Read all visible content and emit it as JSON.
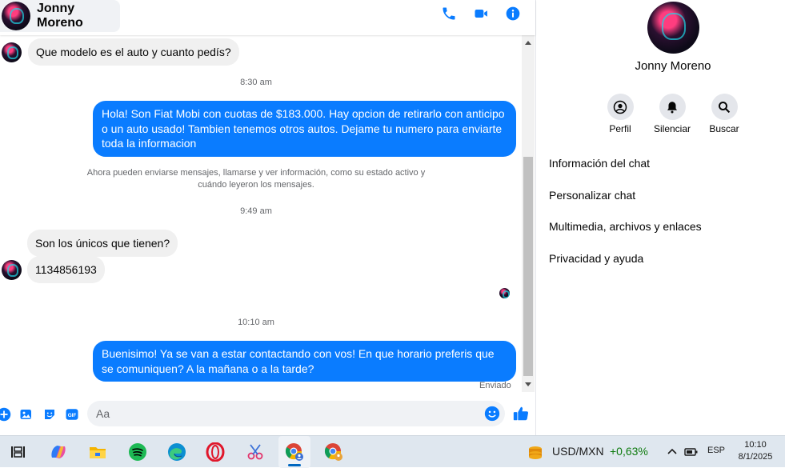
{
  "contact": {
    "name": "Jonny Moreno"
  },
  "messages": {
    "incoming_1": "Que modelo es el auto y cuanto pedís?",
    "time_1": "8:30 am",
    "outgoing_1": "Hola! Son Fiat Mobi con cuotas de $183.000. Hay opcion de retirarlo con anticipo o un auto usado! Tambien tenemos otros autos. Dejame tu numero para enviarte toda la informacion",
    "notice": "Ahora pueden enviarse mensajes, llamarse y ver información, como su estado activo y cuándo leyeron los mensajes.",
    "time_2": "9:49 am",
    "incoming_2": "Son los únicos que tienen?",
    "incoming_3": "1134856193",
    "time_3": "10:10 am",
    "outgoing_2": "Buenisimo! Ya se van a estar contactando con vos! En que horario preferis que se comuniquen? A la mañana o a la tarde?",
    "status": "Enviado"
  },
  "composer": {
    "placeholder": "Aa"
  },
  "panel": {
    "name": "Jonny Moreno",
    "actions": [
      "Perfil",
      "Silenciar",
      "Buscar"
    ],
    "menu": [
      "Información del chat",
      "Personalizar chat",
      "Multimedia, archivos y enlaces",
      "Privacidad y ayuda"
    ]
  },
  "taskbar": {
    "ticker": "USD/MXN",
    "change": "+0,63%",
    "change_color": "#0f7b0f",
    "language": "ESP",
    "time": "10:10",
    "date": "8/1/2025"
  },
  "colors": {
    "accent": "#0a7cff",
    "incoming_bubble": "#f0f0f0"
  }
}
